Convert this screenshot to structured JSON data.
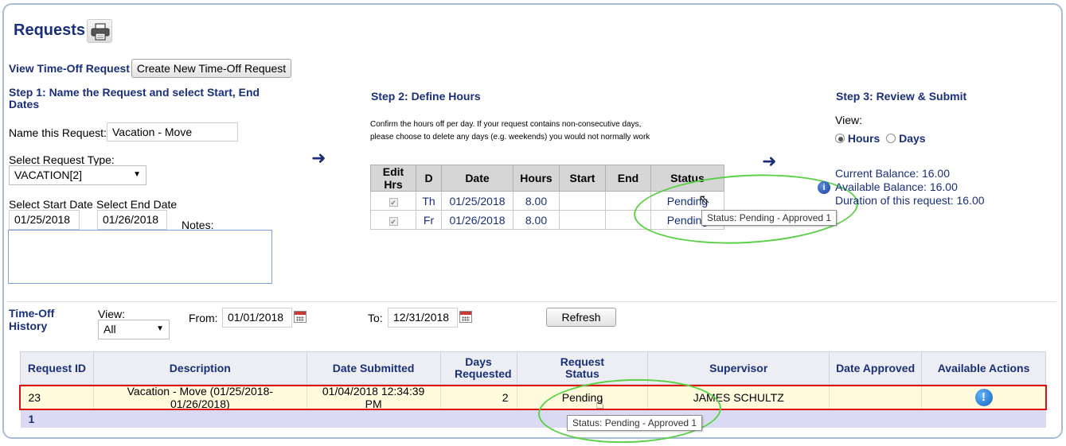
{
  "header": {
    "title": "Requests",
    "printer_icon": "printer-icon"
  },
  "toolbar": {
    "view_label": "View Time-Off Request",
    "create_button": "Create New Time-Off Request"
  },
  "step1": {
    "heading_line1": "Step 1: Name the Request and select Start, End",
    "heading_line2": "Dates",
    "name_label": "Name this Request:",
    "name_value": "Vacation - Move",
    "type_label": "Select Request Type:",
    "type_value": "VACATION[2]",
    "start_label": "Select Start Date",
    "start_value": "01/25/2018",
    "end_label": "Select End Date",
    "end_value": "01/26/2018",
    "notes_label": "Notes:"
  },
  "step2": {
    "heading": "Step 2: Define Hours",
    "instructions_line1": "Confirm the hours off per day. If your request contains non-consecutive days,",
    "instructions_line2": "please choose to delete any days (e.g. weekends) you would not normally work",
    "columns": [
      "Edit Hrs",
      "D",
      "Date",
      "Hours",
      "Start",
      "End",
      "Status"
    ],
    "rows": [
      {
        "checked": "✔",
        "day": "Th",
        "date": "01/25/2018",
        "hours": "8.00",
        "start": "",
        "end": "",
        "status": "Pending"
      },
      {
        "checked": "✔",
        "day": "Fr",
        "date": "01/26/2018",
        "hours": "8.00",
        "start": "",
        "end": "",
        "status": "Pending"
      }
    ],
    "tooltip": "Status: Pending - Approved 1"
  },
  "step3": {
    "heading": "Step 3: Review & Submit",
    "view_label": "View:",
    "option_hours": "Hours",
    "option_days": "Days",
    "current_balance": "Current Balance: 16.00",
    "available_balance": "Available Balance: 16.00",
    "duration": "Duration of this request: 16.00"
  },
  "history": {
    "label_line1": "Time-Off",
    "label_line2": "History",
    "view_label": "View:",
    "view_value": "All",
    "from_label": "From:",
    "from_value": "01/01/2018",
    "to_label": "To:",
    "to_value": "12/31/2018",
    "refresh_button": "Refresh",
    "columns": [
      "Request ID",
      "Description",
      "Date Submitted",
      "Days Requested",
      "Request Status",
      "Supervisor",
      "Date Approved",
      "Available Actions"
    ],
    "rows": [
      {
        "id": "23",
        "description": "Vacation - Move (01/25/2018-01/26/2018)",
        "submitted": "01/04/2018 12:34:39 PM",
        "days": "2",
        "status": "Pending",
        "supervisor": "JAMES SCHULTZ",
        "approved": "",
        "action": "!"
      }
    ],
    "page": "1",
    "tooltip": "Status: Pending - Approved 1"
  },
  "colors": {
    "navy": "#1a2f7a",
    "highlight_green": "#5ad146",
    "row_outline_red": "#e11010",
    "row_yellow": "#fffbdc"
  }
}
